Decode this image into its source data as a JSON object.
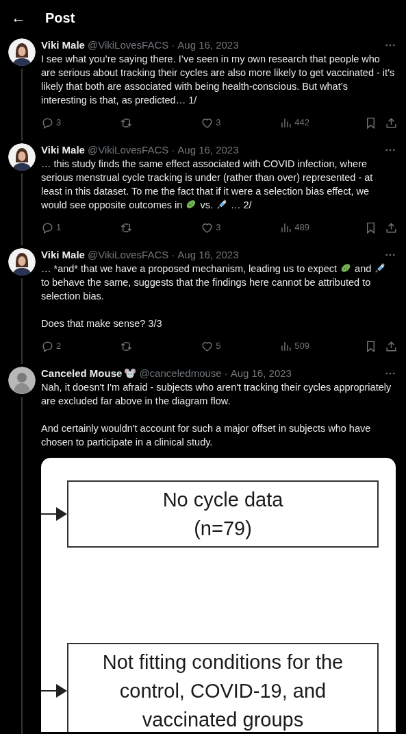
{
  "header": {
    "back": "←",
    "title": "Post"
  },
  "posts": [
    {
      "avatar": {
        "kind": "woman"
      },
      "name": "Viki Male",
      "handle": "@VikiLovesFACS",
      "separator": "·",
      "date": "Aug 16, 2023",
      "thread_line": true,
      "paragraphs": [
        [
          {
            "kind": "text",
            "text": "I see what you’re saying there. I’ve seen in my own research that people who are serious about tracking their cycles are also more likely to get vaccinated - it’s likely that both are associated with being health-conscious. But what’s interesting is that, as predicted… 1/"
          }
        ]
      ],
      "stats": {
        "replies": "3",
        "likes": "3",
        "views": "442"
      }
    },
    {
      "avatar": {
        "kind": "woman"
      },
      "name": "Viki Male",
      "handle": "@VikiLovesFACS",
      "separator": "·",
      "date": "Aug 16, 2023",
      "thread_line": true,
      "paragraphs": [
        [
          {
            "kind": "text",
            "text": "… this study finds the same effect associated with COVID infection, where serious menstrual cycle tracking is under (rather than over) represented - at least in this dataset. To me the fact that if it were a selection bias effect, we would see opposite outcomes in "
          },
          {
            "kind": "microbe"
          },
          {
            "kind": "text",
            "text": " vs. "
          },
          {
            "kind": "syringe"
          },
          {
            "kind": "text",
            "text": " … 2/"
          }
        ]
      ],
      "stats": {
        "replies": "1",
        "likes": "3",
        "views": "489"
      }
    },
    {
      "avatar": {
        "kind": "woman"
      },
      "name": "Viki Male",
      "handle": "@VikiLovesFACS",
      "separator": "·",
      "date": "Aug 16, 2023",
      "thread_line": true,
      "paragraphs": [
        [
          {
            "kind": "text",
            "text": "… *and* that we have a proposed mechanism, leading us to expect "
          },
          {
            "kind": "microbe"
          },
          {
            "kind": "text",
            "text": " and "
          },
          {
            "kind": "syringe"
          },
          {
            "kind": "text",
            "text": " to behave the same, suggests that the findings here cannot be attributed to selection bias."
          }
        ],
        [
          {
            "kind": "text",
            "text": "Does that make sense? 3/3"
          }
        ]
      ],
      "stats": {
        "replies": "2",
        "likes": "5",
        "views": "509"
      }
    },
    {
      "avatar": {
        "kind": "grey"
      },
      "name": "Canceled Mouse",
      "name_icon": {
        "kind": "mouse"
      },
      "handle": "@canceledmouse",
      "separator": "·",
      "date": "Aug 16, 2023",
      "thread_line": true,
      "paragraphs": [
        [
          {
            "kind": "text",
            "text": "Nah, it doesn't I'm afraid - subjects who aren't tracking their cycles appropriately are excluded far above in the diagram flow."
          }
        ],
        [
          {
            "kind": "text",
            "text": "And certainly wouldn't account for such a major offset in subjects who have chosen to participate in a clinical study."
          }
        ]
      ],
      "attachment": {
        "kind": "flow_diagram",
        "boxes": [
          {
            "lines": [
              "No cycle data",
              "(n=79)"
            ]
          },
          {
            "lines": [
              "Not fitting conditions for the",
              "control, COVID-19, and",
              "vaccinated groups"
            ]
          }
        ]
      }
    }
  ]
}
